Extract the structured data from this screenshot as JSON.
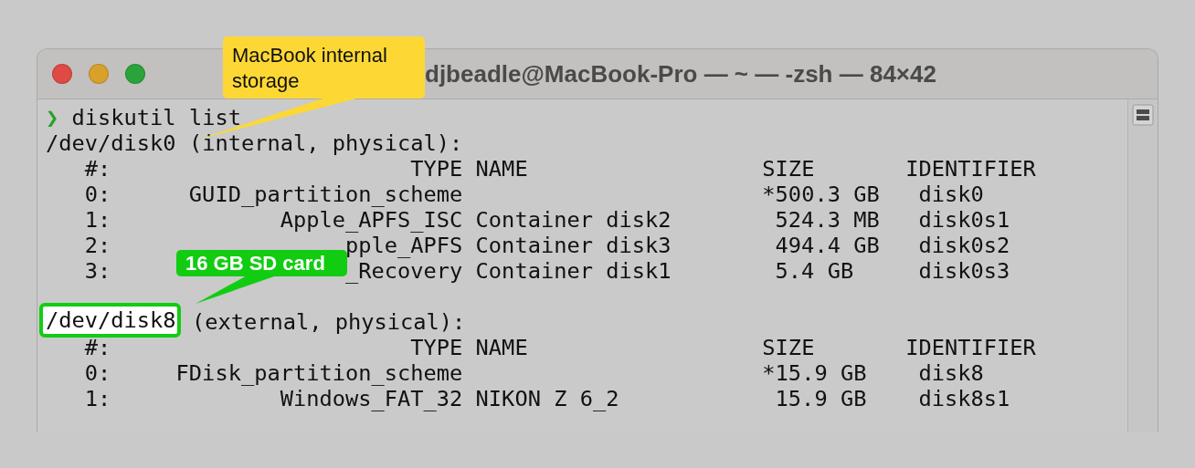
{
  "window": {
    "title": "djbeadle@MacBook-Pro — ~ — -zsh — 84×42"
  },
  "prompt": {
    "symbol": "❯",
    "command": "diskutil list"
  },
  "disks": [
    {
      "device": "/dev/disk0",
      "description": " (internal, physical):",
      "highlighted": false,
      "columns": [
        "#:",
        "TYPE",
        "NAME",
        "SIZE",
        "IDENTIFIER"
      ],
      "partitions": [
        {
          "index": "0:",
          "type": "GUID_partition_scheme",
          "size": "*500.3 GB",
          "identifier": "disk0"
        },
        {
          "index": "1:",
          "type": "Apple_APFS_ISC",
          "name": "Container disk2",
          "size": "524.3 MB",
          "identifier": "disk0s1"
        },
        {
          "index": "2:",
          "type": "pple_APFS",
          "name": "Container disk3",
          "size": "494.4 GB",
          "identifier": "disk0s2"
        },
        {
          "index": "3:",
          "type": "_Recovery",
          "name": "Container disk1",
          "size": "5.4 GB",
          "identifier": "disk0s3"
        }
      ]
    },
    {
      "device": "/dev/disk8",
      "description": " (external, physical):",
      "highlighted": true,
      "columns": [
        "#:",
        "TYPE",
        "NAME",
        "SIZE",
        "IDENTIFIER"
      ],
      "partitions": [
        {
          "index": "0:",
          "type": "FDisk_partition_scheme",
          "size": "*15.9 GB",
          "identifier": "disk8"
        },
        {
          "index": "1:",
          "type": "Windows_FAT_32",
          "name": "NIKON Z 6_2",
          "size": "15.9 GB",
          "identifier": "disk8s1"
        }
      ]
    }
  ],
  "callouts": [
    {
      "text": "MacBook internal storage",
      "color": "#fdd835"
    },
    {
      "text": "16 GB SD card",
      "color": "#12cc12"
    }
  ]
}
